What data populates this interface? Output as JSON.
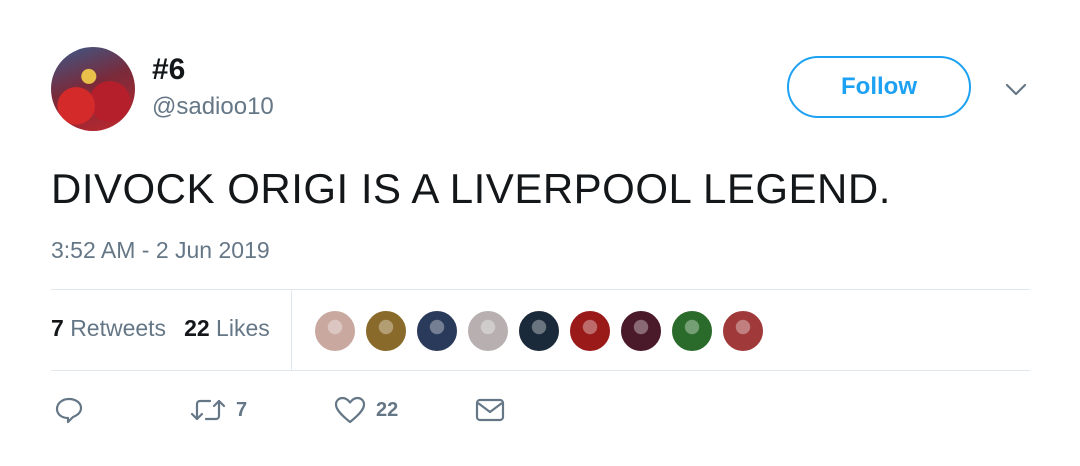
{
  "user": {
    "display_name": "#6",
    "handle": "@sadioo10",
    "avatar_icon": "avatar-photo"
  },
  "header": {
    "follow_label": "Follow",
    "menu_icon": "chevron-down-icon"
  },
  "tweet": {
    "text": "DIVOCK ORIGI IS A LIVERPOOL LEGEND.",
    "timestamp": "3:52 AM - 2 Jun 2019"
  },
  "stats": {
    "retweets_count": "7",
    "retweets_label": "Retweets",
    "likes_count": "22",
    "likes_label": "Likes"
  },
  "likers": [
    {
      "name": "liker-avatar-1",
      "color": "#c9a8a0"
    },
    {
      "name": "liker-avatar-2",
      "color": "#8a6a2a"
    },
    {
      "name": "liker-avatar-3",
      "color": "#2a3a5a"
    },
    {
      "name": "liker-avatar-4",
      "color": "#b8b0b0"
    },
    {
      "name": "liker-avatar-5",
      "color": "#1a2a3a"
    },
    {
      "name": "liker-avatar-6",
      "color": "#9a1a1a"
    },
    {
      "name": "liker-avatar-7",
      "color": "#4a1a2a"
    },
    {
      "name": "liker-avatar-8",
      "color": "#2a6a2a"
    },
    {
      "name": "liker-avatar-9",
      "color": "#a03a3a"
    }
  ],
  "actions": {
    "reply_icon": "reply-icon",
    "retweet_icon": "retweet-icon",
    "retweet_count": "7",
    "like_icon": "heart-icon",
    "like_count": "22",
    "dm_icon": "envelope-icon"
  },
  "colors": {
    "accent": "#1da1f2",
    "secondary_text": "#657786",
    "primary_text": "#14171a",
    "divider": "#e1e8ed"
  }
}
